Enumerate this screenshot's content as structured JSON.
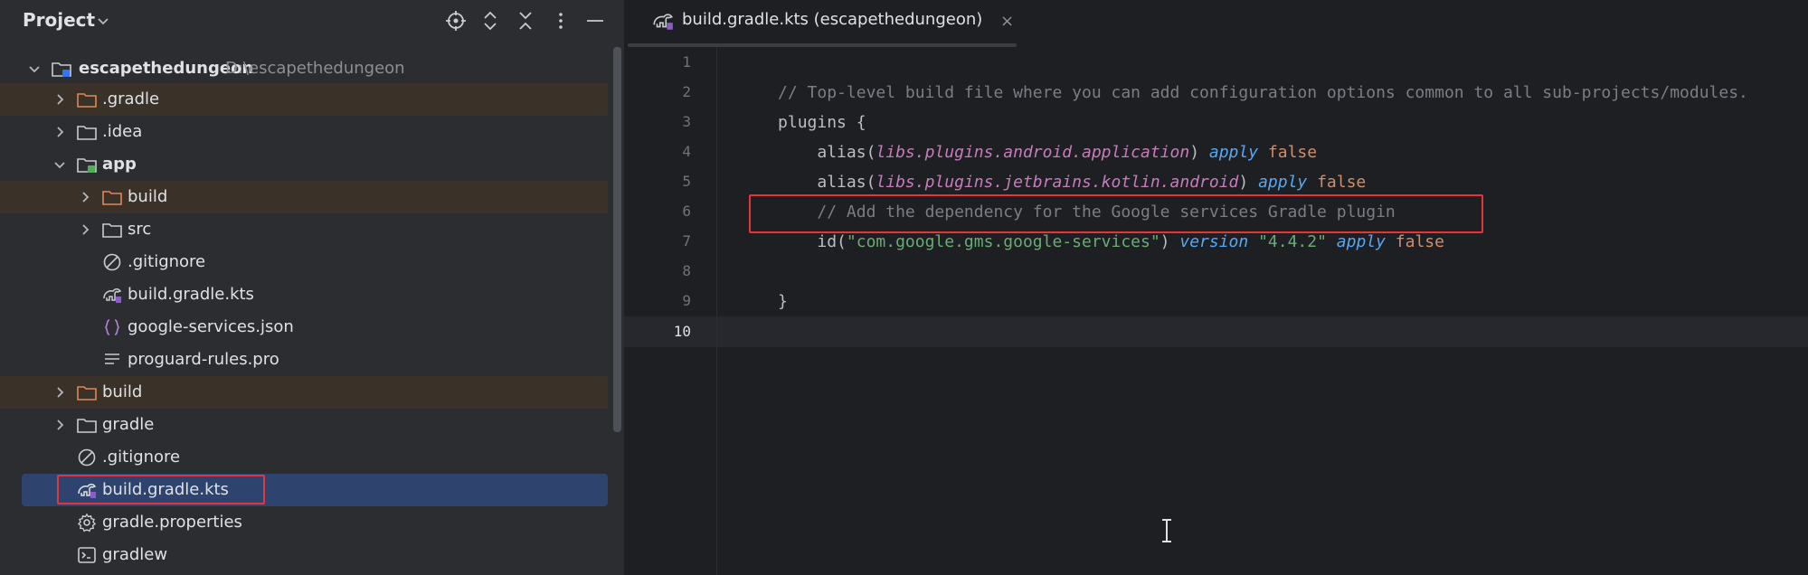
{
  "project_panel": {
    "title": "Project",
    "actions": [
      "locate-icon",
      "expand-all-icon",
      "collapse-all-icon",
      "more-options-icon",
      "hide-icon"
    ],
    "tree": [
      {
        "label": "escapethedungeon",
        "path": "D:\\escapethedungeon",
        "type": "module-folder",
        "expanded": true,
        "depth": 0
      },
      {
        "label": ".gradle",
        "type": "folder",
        "excluded": true,
        "depth": 1
      },
      {
        "label": ".idea",
        "type": "folder",
        "depth": 1
      },
      {
        "label": "app",
        "type": "module-folder",
        "expanded": true,
        "depth": 1
      },
      {
        "label": "build",
        "type": "folder",
        "excluded": true,
        "depth": 2
      },
      {
        "label": "src",
        "type": "folder",
        "depth": 2
      },
      {
        "label": ".gitignore",
        "type": "ignore-file",
        "depth": 2
      },
      {
        "label": "build.gradle.kts",
        "type": "gradle-file",
        "depth": 2
      },
      {
        "label": "google-services.json",
        "type": "json-file",
        "depth": 2
      },
      {
        "label": "proguard-rules.pro",
        "type": "text-file",
        "depth": 2
      },
      {
        "label": "build",
        "type": "folder",
        "excluded": true,
        "depth": 1
      },
      {
        "label": "gradle",
        "type": "folder",
        "depth": 1
      },
      {
        "label": ".gitignore",
        "type": "ignore-file",
        "depth": 1
      },
      {
        "label": "build.gradle.kts",
        "type": "gradle-file",
        "selected": true,
        "depth": 1
      },
      {
        "label": "gradle.properties",
        "type": "settings-file",
        "depth": 1
      },
      {
        "label": "gradlew",
        "type": "terminal-file",
        "depth": 1
      }
    ]
  },
  "editor": {
    "tab": {
      "title": "build.gradle.kts (escapethedungeon)",
      "close": "×"
    },
    "line_numbers": [
      "1",
      "2",
      "3",
      "4",
      "5",
      "6",
      "7",
      "8",
      "9",
      "10"
    ],
    "current_line": "10",
    "code": {
      "l1": "// Top-level build file where you can add configuration options common to all sub-projects/modules.",
      "l2_a": "plugins",
      "l2_b": " {",
      "l3_a": "    alias(",
      "l3_b": "libs.plugins.android.application",
      "l3_c": ") ",
      "l3_d": "apply",
      "l3_e": " false",
      "l4_a": "    alias(",
      "l4_b": "libs.plugins.jetbrains.kotlin.android",
      "l4_c": ") ",
      "l4_d": "apply",
      "l4_e": " false",
      "l5": "    // Add the dependency for the Google services Gradle plugin",
      "l6_a": "    id(",
      "l6_b": "\"com.google.gms.google-services\"",
      "l6_c": ") ",
      "l6_d": "version",
      "l6_e": " ",
      "l6_f": "\"4.4.2\"",
      "l6_g": " ",
      "l6_h": "apply",
      "l6_i": " false",
      "l8": "}"
    }
  },
  "colors": {
    "highlight_box": "#e0363c",
    "selection": "#2e436e",
    "excluded_row": "#3a3128"
  }
}
